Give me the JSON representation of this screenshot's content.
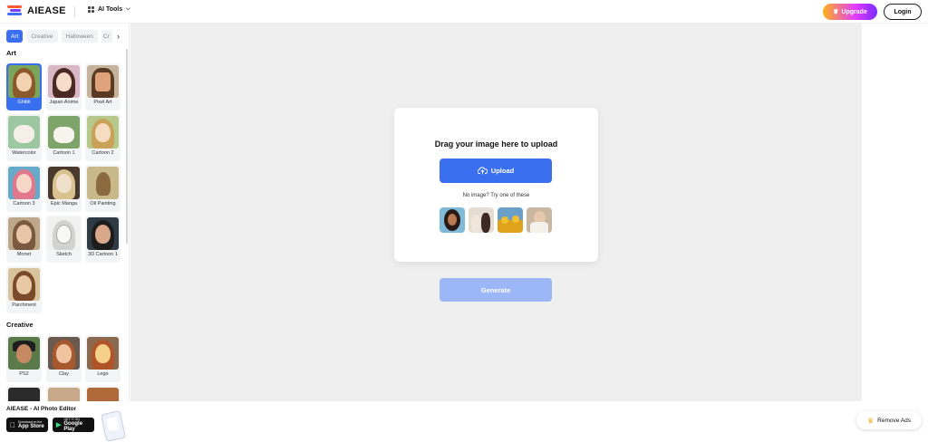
{
  "header": {
    "logo_text": "AIEASE",
    "ai_tools_label": "AI Tools",
    "upgrade_label": "Upgrade",
    "login_label": "Login"
  },
  "sidebar": {
    "tabs": [
      "Art",
      "Creative",
      "Halloween",
      "Cr"
    ],
    "active_tab": "Art",
    "sections": [
      {
        "title": "Art",
        "items": [
          "Ghibli",
          "Japan Anime",
          "Pixel Art",
          "Watercolor",
          "Cartoon 1",
          "Cartoon 2",
          "Cartoon 3",
          "Epic Manga",
          "Oil Painting",
          "Monet",
          "Sketch",
          "3D Cartoon 1",
          "Parchment"
        ]
      },
      {
        "title": "Creative",
        "items": [
          "PS2",
          "Clay",
          "Lego"
        ]
      }
    ],
    "selected_item": "Ghibli"
  },
  "main": {
    "upload_title": "Drag your image here to upload",
    "upload_button": "Upload",
    "try_text": "No image? Try one of these",
    "generate_button": "Generate"
  },
  "appbar": {
    "title": "AIEASE - AI Photo Editor",
    "app_store_small": "Download on the",
    "app_store": "App Store",
    "google_play_small": "GET IT ON",
    "google_play": "Google Play"
  },
  "remove_ads_label": "Remove Ads",
  "colors": {
    "accent": "#3a6ff0",
    "generate_disabled": "#9bb7f7"
  }
}
